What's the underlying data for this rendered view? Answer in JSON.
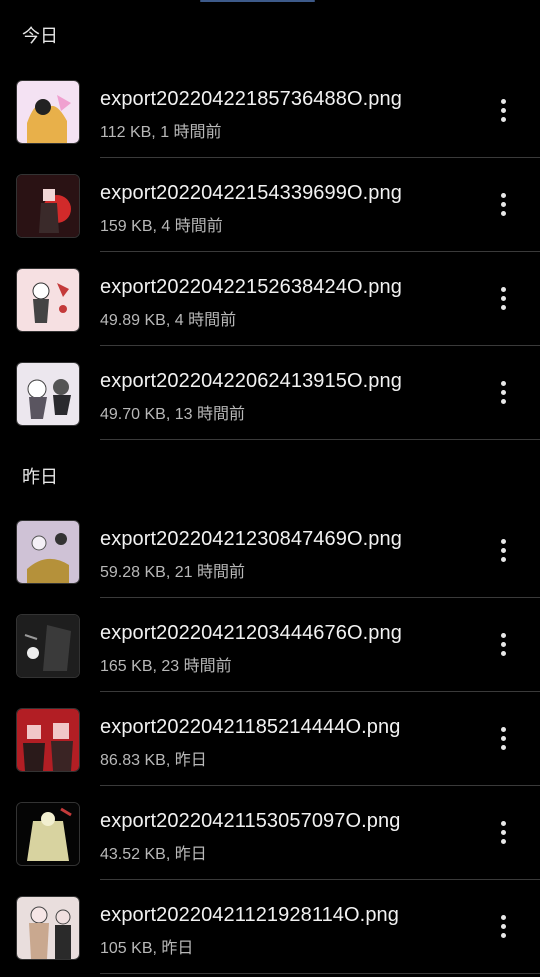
{
  "sections": [
    {
      "label": "今日"
    },
    {
      "label": "昨日"
    }
  ],
  "files": [
    {
      "name": "export20220422185736488O.png",
      "meta": "112 KB, 1 時間前",
      "thumb_bg": "#f4e2f3",
      "thumb_accent": "#e8b04a"
    },
    {
      "name": "export20220422154339699O.png",
      "meta": "159 KB, 4 時間前",
      "thumb_bg": "#2a1214",
      "thumb_accent": "#d12a2a"
    },
    {
      "name": "export20220422152638424O.png",
      "meta": "49.89 KB, 4 時間前",
      "thumb_bg": "#f6e0e2",
      "thumb_accent": "#c43a3a"
    },
    {
      "name": "export20220422062413915O.png",
      "meta": "49.70 KB, 13 時間前",
      "thumb_bg": "#ece7ee",
      "thumb_accent": "#5a5560"
    },
    {
      "name": "export20220421230847469O.png",
      "meta": "59.28 KB, 21 時間前",
      "thumb_bg": "#cfc2d6",
      "thumb_accent": "#b5913a"
    },
    {
      "name": "export20220421203444676O.png",
      "meta": "165 KB, 23 時間前",
      "thumb_bg": "#1e1e1e",
      "thumb_accent": "#9a9a9a"
    },
    {
      "name": "export20220421185214444O.png",
      "meta": "86.83 KB, 昨日",
      "thumb_bg": "#b21e24",
      "thumb_accent": "#f1c7c8"
    },
    {
      "name": "export20220421153057097O.png",
      "meta": "43.52 KB, 昨日",
      "thumb_bg": "#050505",
      "thumb_accent": "#d8d3a0"
    },
    {
      "name": "export20220421121928114O.png",
      "meta": "105 KB, 昨日",
      "thumb_bg": "#e9dedd",
      "thumb_accent": "#c9a88f"
    }
  ],
  "icons": {
    "more": "more-vert-icon"
  }
}
